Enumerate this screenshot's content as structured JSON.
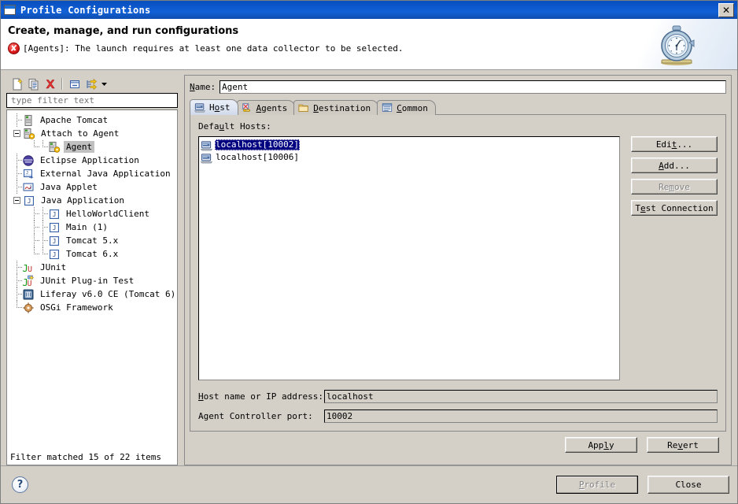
{
  "window": {
    "title": "Profile Configurations",
    "close_label": "✕",
    "icon": "window-icon"
  },
  "banner": {
    "title": "Create, manage, and run configurations",
    "message": "[Agents]: The launch requires at least one data collector to be selected.",
    "error_icon": "error-icon",
    "decor_icon": "stopwatch-icon"
  },
  "toolbar": {
    "buttons": [
      {
        "name": "new-configuration",
        "icon": "new-document-icon"
      },
      {
        "name": "duplicate-configuration",
        "icon": "copy-document-icon"
      },
      {
        "name": "delete-configuration",
        "icon": "red-x-delete-icon"
      },
      {
        "name": "collapse-all",
        "icon": "collapse-all-icon"
      },
      {
        "name": "filter-configurations",
        "icon": "filter-arrow-icon"
      },
      {
        "name": "toolbar-menu",
        "icon": "chevron-down-icon"
      }
    ]
  },
  "filter": {
    "placeholder": "type filter text",
    "value": "",
    "status": "Filter matched 15 of 22 items"
  },
  "tree": {
    "items": [
      {
        "label": "Apache Tomcat",
        "depth": 0,
        "twisty": "none",
        "icon": "tomcat-server-icon",
        "selected": false,
        "last": false
      },
      {
        "label": "Attach to Agent",
        "depth": 0,
        "twisty": "expanded",
        "icon": "attach-agent-icon",
        "selected": false,
        "last": false
      },
      {
        "label": "Agent",
        "depth": 1,
        "twisty": "none",
        "icon": "agent-icon",
        "selected": true,
        "last": true
      },
      {
        "label": "Eclipse Application",
        "depth": 0,
        "twisty": "none",
        "icon": "eclipse-icon",
        "selected": false,
        "last": false
      },
      {
        "label": "External Java Application",
        "depth": 0,
        "twisty": "none",
        "icon": "external-java-icon",
        "selected": false,
        "last": false
      },
      {
        "label": "Java Applet",
        "depth": 0,
        "twisty": "none",
        "icon": "java-applet-icon",
        "selected": false,
        "last": false
      },
      {
        "label": "Java Application",
        "depth": 0,
        "twisty": "expanded",
        "icon": "java-application-icon",
        "selected": false,
        "last": false
      },
      {
        "label": "HelloWorldClient",
        "depth": 1,
        "twisty": "none",
        "icon": "java-application-icon",
        "selected": false,
        "last": false
      },
      {
        "label": "Main (1)",
        "depth": 1,
        "twisty": "none",
        "icon": "java-application-icon",
        "selected": false,
        "last": false
      },
      {
        "label": "Tomcat 5.x",
        "depth": 1,
        "twisty": "none",
        "icon": "java-application-icon",
        "selected": false,
        "last": false
      },
      {
        "label": "Tomcat 6.x",
        "depth": 1,
        "twisty": "none",
        "icon": "java-application-icon",
        "selected": false,
        "last": true
      },
      {
        "label": "JUnit",
        "depth": 0,
        "twisty": "none",
        "icon": "junit-icon",
        "selected": false,
        "last": false
      },
      {
        "label": "JUnit Plug-in Test",
        "depth": 0,
        "twisty": "none",
        "icon": "junit-plugin-icon",
        "selected": false,
        "last": false
      },
      {
        "label": "Liferay v6.0 CE (Tomcat 6)",
        "depth": 0,
        "twisty": "none",
        "icon": "liferay-icon",
        "selected": false,
        "last": false
      },
      {
        "label": "OSGi Framework",
        "depth": 0,
        "twisty": "none",
        "icon": "osgi-icon",
        "selected": false,
        "last": true
      }
    ]
  },
  "config": {
    "name_label": "Name:",
    "name_value": "Agent",
    "tabs": [
      {
        "label": "Host",
        "mnemonic": "o",
        "icon": "host-computer-icon",
        "active": true
      },
      {
        "label": "Agents",
        "mnemonic": "A",
        "icon": "agents-icon",
        "active": false
      },
      {
        "label": "Destination",
        "mnemonic": "D",
        "icon": "folder-icon",
        "active": false
      },
      {
        "label": "Common",
        "mnemonic": "C",
        "icon": "common-list-icon",
        "active": false
      }
    ],
    "host_tab": {
      "section_label": "Default Hosts:",
      "hosts": [
        {
          "label": "localhost[10002]",
          "selected": true,
          "icon": "host-computer-icon"
        },
        {
          "label": "localhost[10006]",
          "selected": false,
          "icon": "host-computer-icon"
        }
      ],
      "buttons": [
        {
          "label": "Edit...",
          "name": "edit-host-button",
          "enabled": true
        },
        {
          "label": "Add...",
          "name": "add-host-button",
          "enabled": true
        },
        {
          "label": "Remove",
          "name": "remove-host-button",
          "enabled": false
        },
        {
          "label": "Test Connection",
          "name": "test-connection-button",
          "enabled": true
        }
      ],
      "fields": [
        {
          "label": "Host name or IP address:",
          "value": "localhost",
          "name": "host-name-field"
        },
        {
          "label": "Agent Controller port:",
          "value": "10002",
          "name": "agent-port-field"
        }
      ]
    },
    "apply_label": "Apply",
    "revert_label": "Revert"
  },
  "footer": {
    "help_label": "?",
    "profile_label": "Profile",
    "close_label": "Close",
    "profile_enabled": false
  },
  "colors": {
    "titlebar": "#0b55c8",
    "face": "#d4d0c8",
    "selection": "#000080",
    "inactive_selection": "#c0c0c0",
    "error": "#e02020"
  }
}
